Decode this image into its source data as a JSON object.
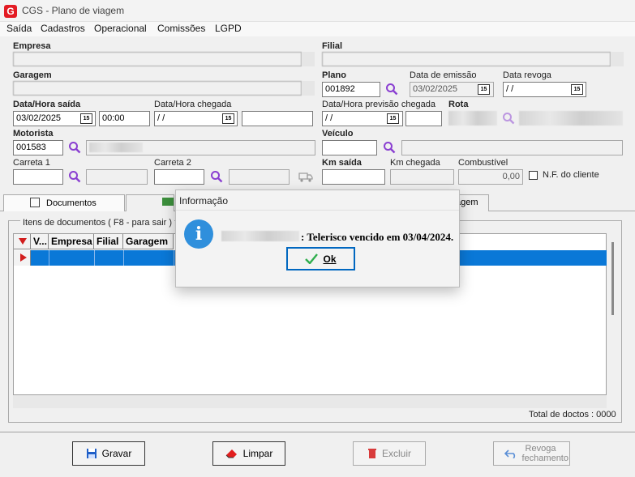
{
  "window": {
    "title": "CGS - Plano de viagem",
    "logo_text": "G"
  },
  "menu": [
    "Saída",
    "Cadastros",
    "Operacional",
    "Comissões",
    "LGPD"
  ],
  "labels": {
    "empresa": "Empresa",
    "filial": "Filial",
    "garagem": "Garagem",
    "plano": "Plano",
    "data_emissao": "Data de emissão",
    "data_revoga": "Data revoga",
    "data_hora_saida": "Data/Hora saída",
    "data_hora_chegada": "Data/Hora chegada",
    "data_hora_prev": "Data/Hora previsão chegada",
    "rota": "Rota",
    "motorista": "Motorista",
    "veiculo": "Veículo",
    "carreta1": "Carreta 1",
    "carreta2": "Carreta 2",
    "km_saida": "Km saída",
    "km_chegada": "Km chegada",
    "combustivel": "Combustível",
    "nf_cliente": "N.F. do cliente"
  },
  "fields": {
    "plano": "001892",
    "data_emissao": "03/02/2025",
    "data_revoga": " / /",
    "data_saida": "03/02/2025",
    "hora_saida": "00:00",
    "data_chegada": " / /",
    "data_prev": " / /",
    "motorista": "001583",
    "combustivel": "0,00"
  },
  "cal_icon": "15",
  "tabs": [
    "Documentos",
    "agem"
  ],
  "grid": {
    "group_label": "Itens de documentos ( F8 - para sair )",
    "columns": [
      "V...",
      "Empresa",
      "Filial",
      "Garagem"
    ],
    "total_label": "Total de doctos : 0000"
  },
  "buttons": {
    "gravar": "Gravar",
    "limpar": "Limpar",
    "excluir": "Excluir",
    "revoga": "Revoga fechamento"
  },
  "dialog": {
    "title": "Informação",
    "message": ": Telerisco vencido em 03/04/2024.",
    "ok": "Ok",
    "icon": "i"
  }
}
